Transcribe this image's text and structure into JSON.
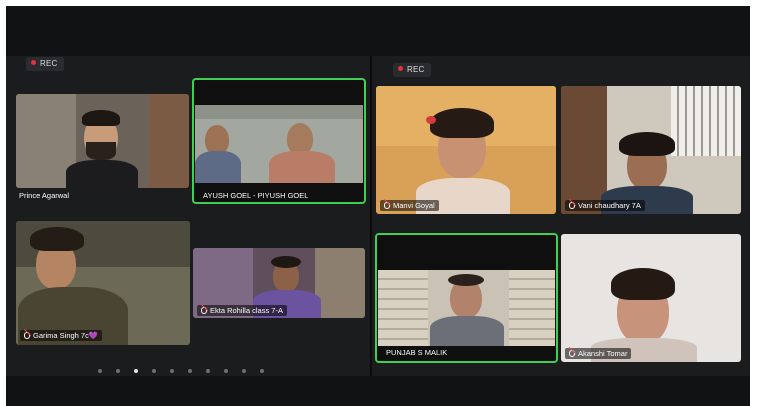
{
  "recording": {
    "label": "REC"
  },
  "colors": {
    "active_speaker_border": "#3fcf57",
    "rec_dot": "#e0333a",
    "background": "#111213"
  },
  "left_panel": {
    "participants": [
      {
        "name": "Prince Agarwal",
        "muted": false,
        "active": false
      },
      {
        "name": "AYUSH GOEL - PIYUSH GOEL",
        "muted": false,
        "active": true
      },
      {
        "name": "Garima Singh 7c",
        "suffix": "💜",
        "muted": true,
        "active": false
      },
      {
        "name": "Ekta Rohilla class 7-A",
        "muted": true,
        "active": false
      }
    ],
    "pager": {
      "pages": 10,
      "current_page": 3
    }
  },
  "right_panel": {
    "participants": [
      {
        "name": "Manvi Goyal",
        "muted": true,
        "active": false
      },
      {
        "name": "Vani chaudhary 7A",
        "muted": true,
        "active": false
      },
      {
        "name": "PUNJAB S MALIK",
        "muted": false,
        "active": true
      },
      {
        "name": "Akanshi Tomar",
        "muted": true,
        "active": false
      }
    ]
  },
  "icons": {
    "mute": "mic-off-icon",
    "recording": "rec-dot-icon"
  }
}
